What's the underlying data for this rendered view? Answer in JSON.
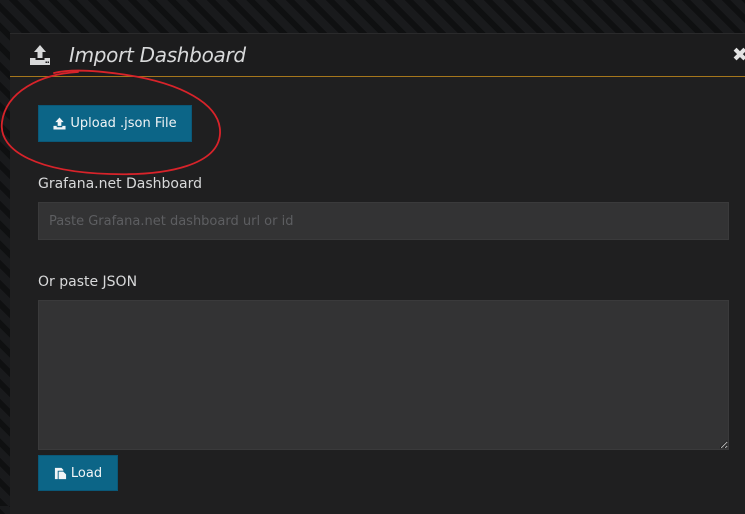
{
  "modal": {
    "title": "Import Dashboard",
    "close_symbol": "✖",
    "header_icon": "upload-icon"
  },
  "upload": {
    "label": "Upload .json File",
    "icon": "upload-icon"
  },
  "grafana_net": {
    "label": "Grafana.net Dashboard",
    "input_value": "",
    "input_placeholder": "Paste Grafana.net dashboard url or id"
  },
  "json": {
    "label": "Or paste JSON",
    "value": ""
  },
  "load": {
    "label": "Load",
    "icon": "file-icon"
  },
  "annotation": {
    "type": "hand-drawn red ellipse around upload button",
    "color": "#d8232a"
  },
  "colors": {
    "primary_button": "#0c6587",
    "header_accent": "#a5761c",
    "modal_background": "#1f1f20",
    "input_background": "#333334"
  }
}
